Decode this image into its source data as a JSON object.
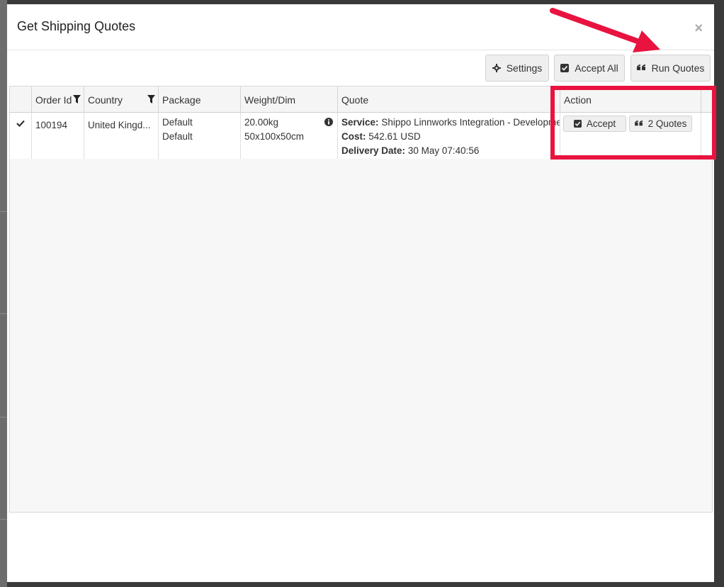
{
  "modal": {
    "title": "Get Shipping Quotes",
    "close_glyph": "×"
  },
  "toolbar": {
    "settings_label": "Settings",
    "accept_all_label": "Accept All",
    "run_quotes_label": "Run Quotes"
  },
  "grid": {
    "columns": {
      "order_id": "Order Id",
      "country": "Country",
      "package": "Package",
      "weight_dim": "Weight/Dim",
      "quote": "Quote",
      "action": "Action"
    },
    "rows": [
      {
        "order_id": "100194",
        "country": "United Kingd...",
        "package_line1": "Default",
        "package_line2": "Default",
        "weight": "20.00kg",
        "dimensions": "50x100x50cm",
        "service_label": "Service:",
        "service_value": "Shippo Linnworks Integration - Developme",
        "cost_label": "Cost:",
        "cost_value": "542.61 USD",
        "delivery_label": "Delivery Date:",
        "delivery_value": "30 May 07:40:56",
        "accept_label": "Accept",
        "quotes_label": "2 Quotes"
      }
    ]
  },
  "colors": {
    "annotation": "#e8133f",
    "overlay": "#3a3a3a"
  }
}
